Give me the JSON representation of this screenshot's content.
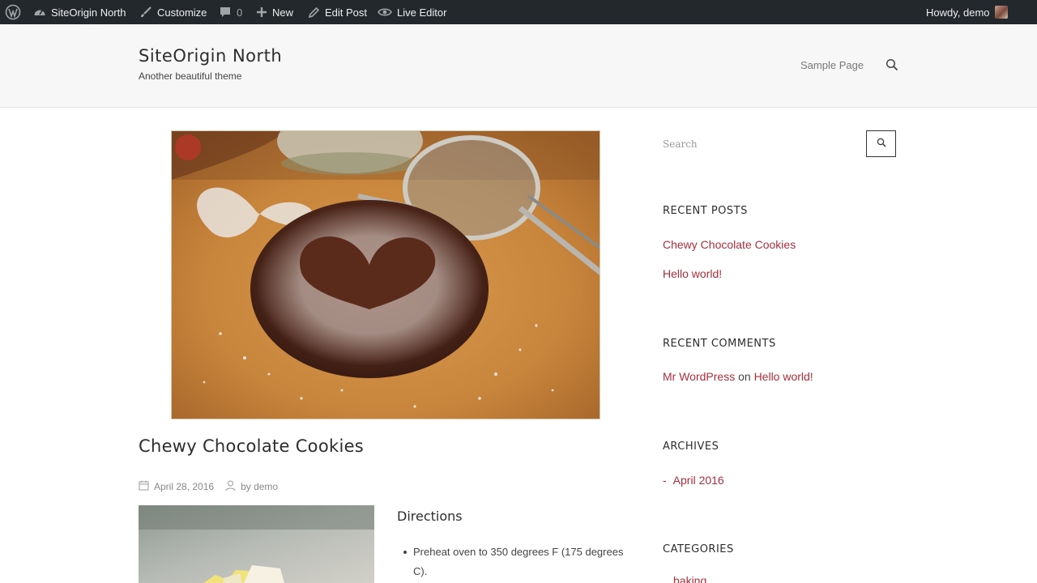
{
  "admin_bar": {
    "site_name": "SiteOrigin North",
    "customize": "Customize",
    "comments_count": "0",
    "new": "New",
    "edit_post": "Edit Post",
    "live_editor": "Live Editor",
    "howdy": "Howdy, demo"
  },
  "header": {
    "title": "SiteOrigin North",
    "description": "Another beautiful theme",
    "nav": [
      "Sample Page"
    ]
  },
  "post": {
    "title": "Chewy Chocolate Cookies",
    "date": "April 28, 2016",
    "author": "by demo",
    "directions_heading": "Directions",
    "directions": [
      "Preheat oven to 350 degrees F (175 degrees C)."
    ]
  },
  "sidebar": {
    "search_placeholder": "Search",
    "recent_posts": {
      "title": "RECENT POSTS",
      "items": [
        "Chewy Chocolate Cookies",
        "Hello world!"
      ]
    },
    "recent_comments": {
      "title": "RECENT COMMENTS",
      "author": "Mr WordPress",
      "on": "on",
      "post": "Hello world!"
    },
    "archives": {
      "title": "ARCHIVES",
      "dash": "-",
      "items": [
        "April 2016"
      ]
    },
    "categories": {
      "title": "CATEGORIES",
      "items": [
        "baking"
      ]
    }
  },
  "colors": {
    "admin_bar_bg": "#23282d",
    "accent_link": "#b32d3a",
    "header_bg": "#f7f7f7"
  }
}
